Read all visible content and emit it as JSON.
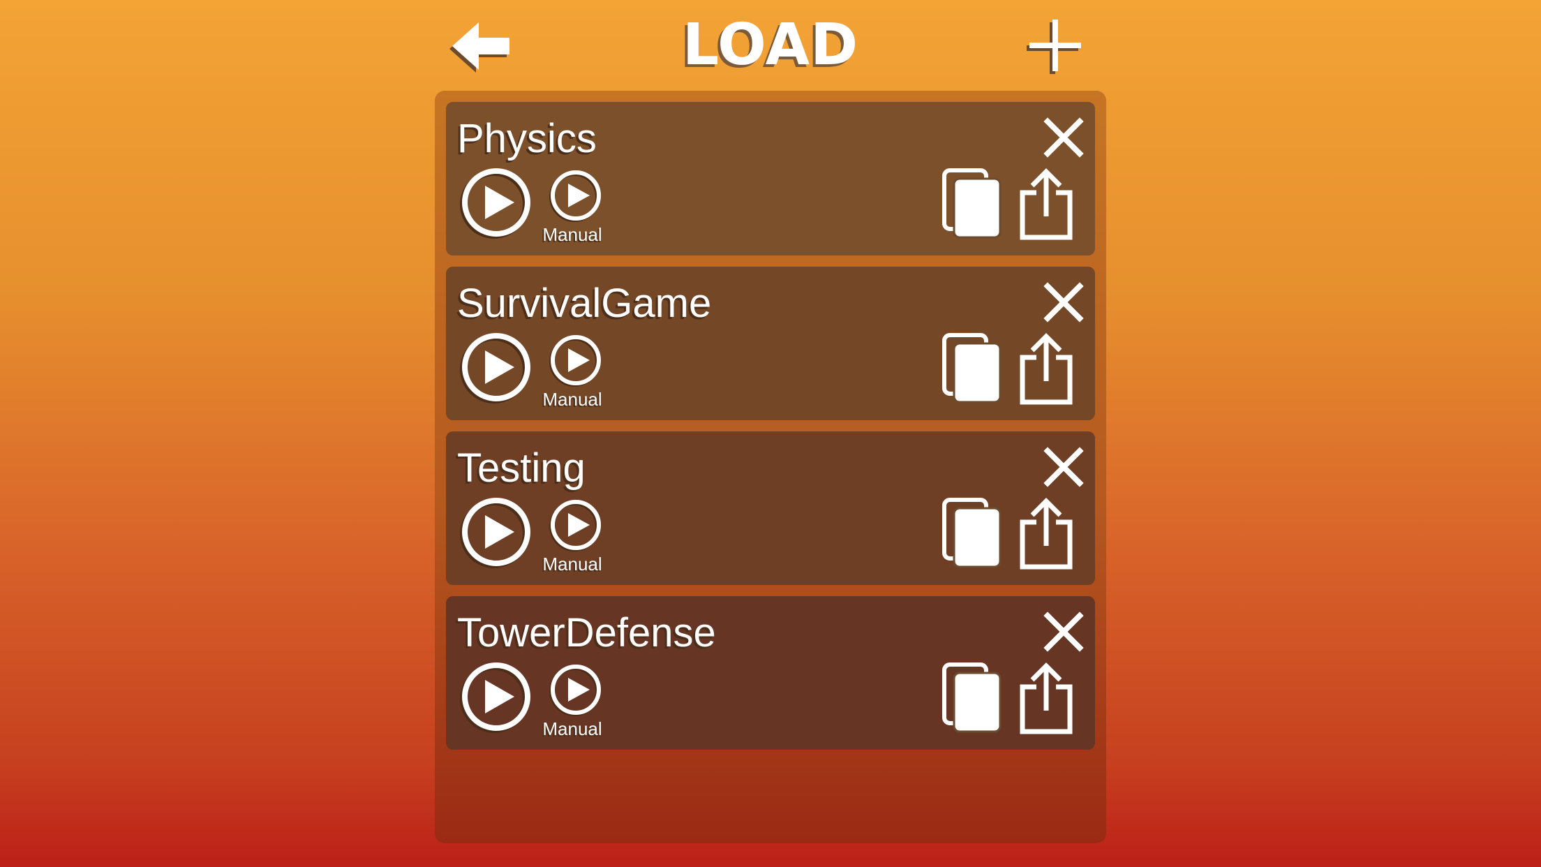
{
  "header": {
    "title": "LOAD",
    "back_icon": "arrow-left-icon",
    "add_icon": "plus-icon"
  },
  "colors": {
    "gradient_top": "#f3a435",
    "gradient_bottom": "#bc1f18",
    "card_bg": "#7a4d2a",
    "icon_fill": "#ffffff"
  },
  "projects": [
    {
      "name": "Physics",
      "manual_label": "Manual"
    },
    {
      "name": "SurvivalGame",
      "manual_label": "Manual"
    },
    {
      "name": "Testing",
      "manual_label": "Manual"
    },
    {
      "name": "TowerDefense",
      "manual_label": "Manual"
    }
  ]
}
